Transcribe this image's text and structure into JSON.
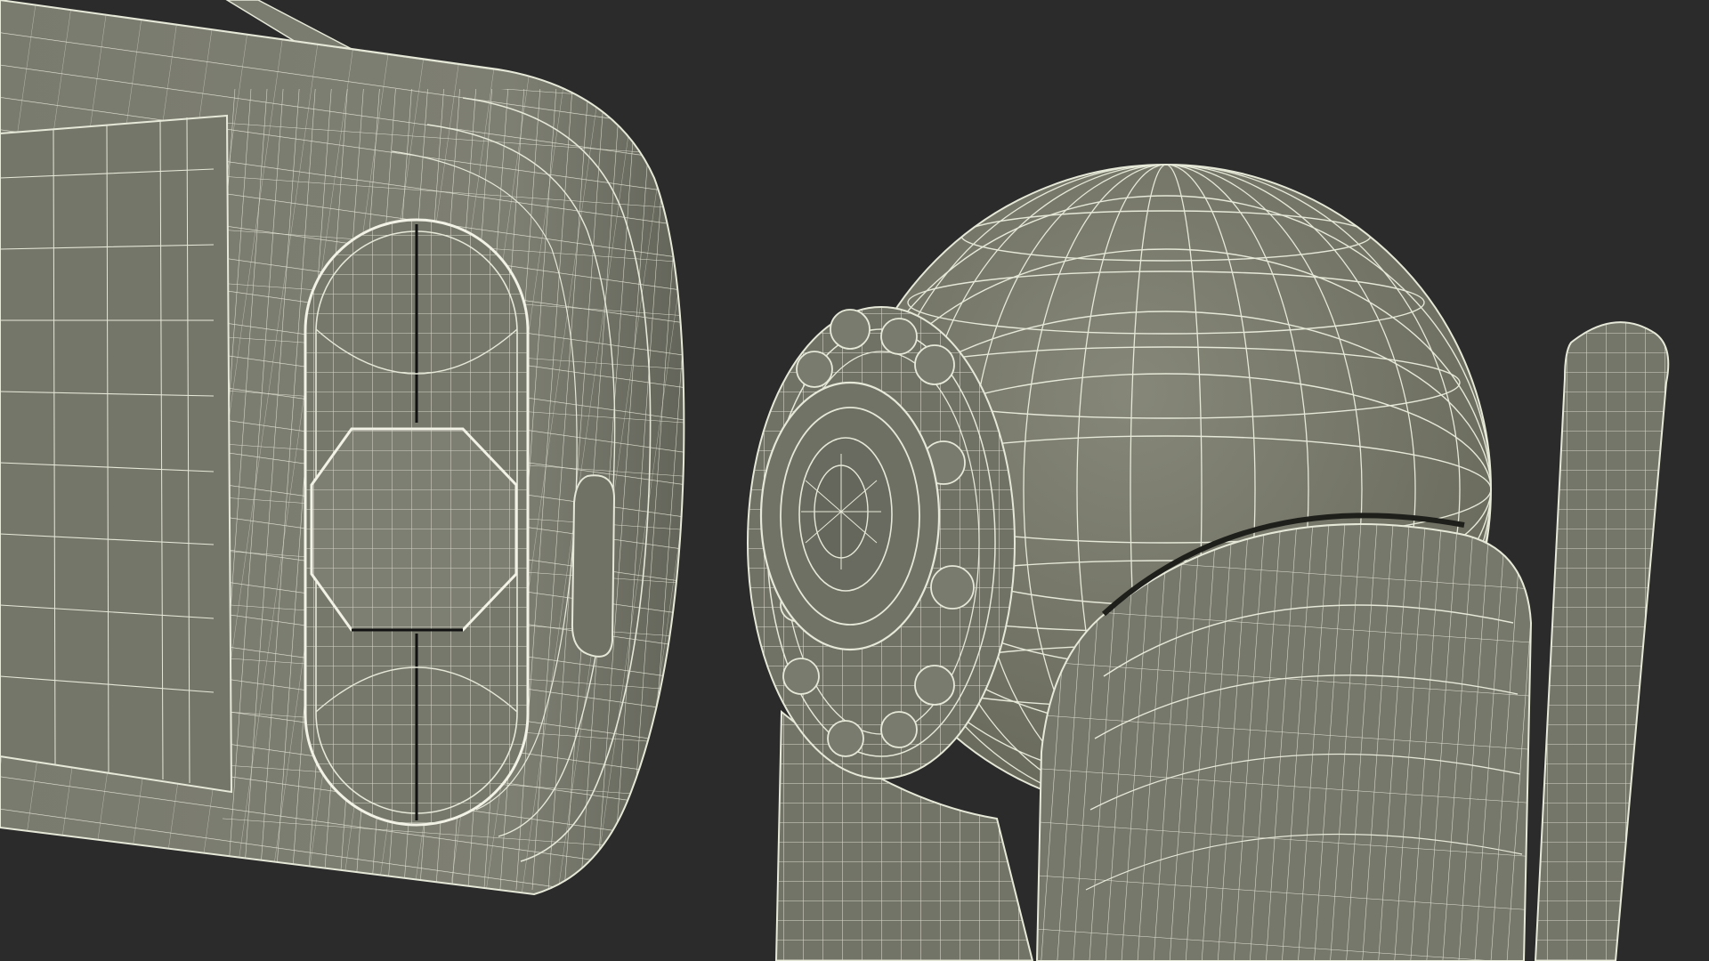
{
  "scene": {
    "background_color": "#2b2b2b",
    "mesh_fill_color": "#7b7c70",
    "mesh_fill_dark": "#6d6e63",
    "wire_color": "#e6e8d8",
    "shadow_color": "#1e1f1b",
    "objects": [
      {
        "name": "monitor-unit",
        "style": "wireframe"
      },
      {
        "name": "camera-unit",
        "style": "wireframe"
      }
    ]
  }
}
